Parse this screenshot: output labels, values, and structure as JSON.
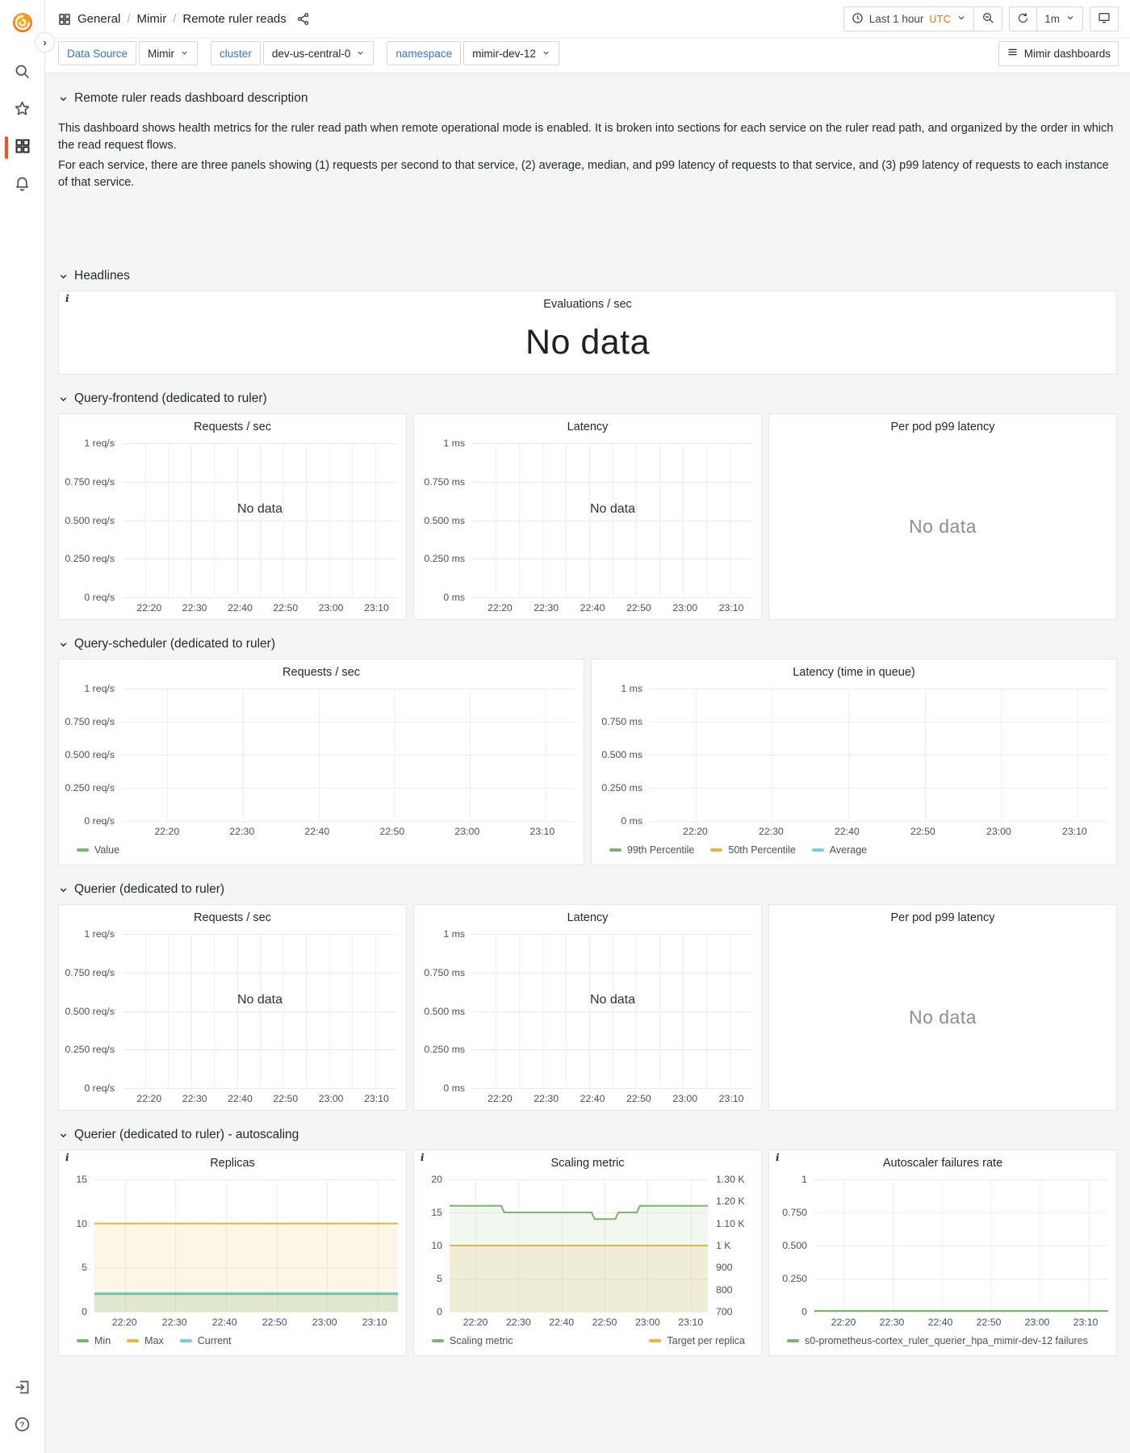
{
  "header": {
    "breadcrumb": {
      "root": "General",
      "sep1": "/",
      "group": "Mimir",
      "sep2": "/",
      "page": "Remote ruler reads"
    },
    "time_picker": {
      "range_label": "Last 1 hour",
      "timezone": "UTC"
    },
    "refresh": {
      "interval": "1m"
    }
  },
  "toolbar": {
    "variables": [
      {
        "label": "Data Source",
        "value": "Mimir"
      },
      {
        "label": "cluster",
        "value": "dev-us-central-0"
      },
      {
        "label": "namespace",
        "value": "mimir-dev-12"
      }
    ],
    "dashboards_button": "Mimir dashboards"
  },
  "sections": {
    "description": {
      "title": "Remote ruler reads dashboard description",
      "paragraph1": "This dashboard shows health metrics for the ruler read path when remote operational mode is enabled. It is broken into sections for each service on the ruler read path, and organized by the order in which the read request flows.",
      "paragraph2": "For each service, there are three panels showing (1) requests per second to that service, (2) average, median, and p99 latency of requests to that service, and (3) p99 latency of requests to each instance of that service."
    },
    "headlines": {
      "title": "Headlines"
    },
    "query_frontend": {
      "title": "Query-frontend (dedicated to ruler)"
    },
    "query_scheduler": {
      "title": "Query-scheduler (dedicated to ruler)"
    },
    "querier": {
      "title": "Querier (dedicated to ruler)"
    },
    "querier_autoscaling": {
      "title": "Querier (dedicated to ruler) - autoscaling"
    }
  },
  "panels": {
    "evaluations": {
      "title": "Evaluations / sec",
      "no_data": "No data"
    },
    "qf_per_pod": {
      "title": "Per pod p99 latency",
      "no_data": "No data"
    },
    "querier_per_pod": {
      "title": "Per pod p99 latency",
      "no_data": "No data"
    }
  },
  "colors": {
    "green": "#7EB26D",
    "yellow": "#EAB839",
    "cyan": "#6ED0E0",
    "link_blue": "#3871DC",
    "utc_orange": "#E87400",
    "active_orange": "#F4511E"
  },
  "chart_data": {
    "qf_requests": {
      "type": "line",
      "title": "Requests / sec",
      "no_data": "No data",
      "ylim": [
        0,
        1
      ],
      "xlim": [
        0,
        60
      ],
      "y_axis_width": 68,
      "v_grid": "fine",
      "y_ticks": [
        {
          "label": "1 req/s",
          "v": 1
        },
        {
          "label": "0.750 req/s",
          "v": 0.75
        },
        {
          "label": "0.500 req/s",
          "v": 0.5
        },
        {
          "label": "0.250 req/s",
          "v": 0.25
        },
        {
          "label": "0 req/s",
          "v": 0
        }
      ],
      "x_ticks": [
        {
          "label": "22:20",
          "v": 6
        },
        {
          "label": "22:30",
          "v": 16
        },
        {
          "label": "22:40",
          "v": 26
        },
        {
          "label": "22:50",
          "v": 36
        },
        {
          "label": "23:00",
          "v": 46
        },
        {
          "label": "23:10",
          "v": 56
        }
      ],
      "series": [],
      "legend": []
    },
    "qf_latency": {
      "type": "line",
      "title": "Latency",
      "no_data": "No data",
      "ylim": [
        0,
        1
      ],
      "xlim": [
        0,
        60
      ],
      "y_axis_width": 62,
      "v_grid": "fine",
      "y_ticks": [
        {
          "label": "1 ms",
          "v": 1
        },
        {
          "label": "0.750 ms",
          "v": 0.75
        },
        {
          "label": "0.500 ms",
          "v": 0.5
        },
        {
          "label": "0.250 ms",
          "v": 0.25
        },
        {
          "label": "0 ms",
          "v": 0
        }
      ],
      "x_ticks": [
        {
          "label": "22:20",
          "v": 6
        },
        {
          "label": "22:30",
          "v": 16
        },
        {
          "label": "22:40",
          "v": 26
        },
        {
          "label": "22:50",
          "v": 36
        },
        {
          "label": "23:00",
          "v": 46
        },
        {
          "label": "23:10",
          "v": 56
        }
      ],
      "series": [],
      "legend": []
    },
    "qs_requests": {
      "type": "line",
      "title": "Requests / sec",
      "ylim": [
        0,
        1
      ],
      "xlim": [
        0,
        60
      ],
      "y_axis_width": 68,
      "v_grid": "ticks",
      "y_ticks": [
        {
          "label": "1 req/s",
          "v": 1
        },
        {
          "label": "0.750 req/s",
          "v": 0.75
        },
        {
          "label": "0.500 req/s",
          "v": 0.5
        },
        {
          "label": "0.250 req/s",
          "v": 0.25
        },
        {
          "label": "0 req/s",
          "v": 0
        }
      ],
      "x_ticks": [
        {
          "label": "22:20",
          "v": 6
        },
        {
          "label": "22:30",
          "v": 16
        },
        {
          "label": "22:40",
          "v": 26
        },
        {
          "label": "22:50",
          "v": 36
        },
        {
          "label": "23:00",
          "v": 46
        },
        {
          "label": "23:10",
          "v": 56
        }
      ],
      "series": [],
      "legend": [
        {
          "label": "Value",
          "color": "#7EB26D"
        }
      ]
    },
    "qs_latency": {
      "type": "line",
      "title": "Latency (time in queue)",
      "ylim": [
        0,
        1
      ],
      "xlim": [
        0,
        60
      ],
      "y_axis_width": 62,
      "v_grid": "ticks",
      "y_ticks": [
        {
          "label": "1 ms",
          "v": 1
        },
        {
          "label": "0.750 ms",
          "v": 0.75
        },
        {
          "label": "0.500 ms",
          "v": 0.5
        },
        {
          "label": "0.250 ms",
          "v": 0.25
        },
        {
          "label": "0 ms",
          "v": 0
        }
      ],
      "x_ticks": [
        {
          "label": "22:20",
          "v": 6
        },
        {
          "label": "22:30",
          "v": 16
        },
        {
          "label": "22:40",
          "v": 26
        },
        {
          "label": "22:50",
          "v": 36
        },
        {
          "label": "23:00",
          "v": 46
        },
        {
          "label": "23:10",
          "v": 56
        }
      ],
      "series": [],
      "legend": [
        {
          "label": "99th Percentile",
          "color": "#7EB26D"
        },
        {
          "label": "50th Percentile",
          "color": "#EAB839"
        },
        {
          "label": "Average",
          "color": "#6ED0E0"
        }
      ]
    },
    "querier_requests": {
      "type": "line",
      "title": "Requests / sec",
      "no_data": "No data",
      "ylim": [
        0,
        1
      ],
      "xlim": [
        0,
        60
      ],
      "y_axis_width": 68,
      "v_grid": "fine",
      "y_ticks": [
        {
          "label": "1 req/s",
          "v": 1
        },
        {
          "label": "0.750 req/s",
          "v": 0.75
        },
        {
          "label": "0.500 req/s",
          "v": 0.5
        },
        {
          "label": "0.250 req/s",
          "v": 0.25
        },
        {
          "label": "0 req/s",
          "v": 0
        }
      ],
      "x_ticks": [
        {
          "label": "22:20",
          "v": 6
        },
        {
          "label": "22:30",
          "v": 16
        },
        {
          "label": "22:40",
          "v": 26
        },
        {
          "label": "22:50",
          "v": 36
        },
        {
          "label": "23:00",
          "v": 46
        },
        {
          "label": "23:10",
          "v": 56
        }
      ],
      "series": [],
      "legend": []
    },
    "querier_latency": {
      "type": "line",
      "title": "Latency",
      "no_data": "No data",
      "ylim": [
        0,
        1
      ],
      "xlim": [
        0,
        60
      ],
      "y_axis_width": 62,
      "v_grid": "fine",
      "y_ticks": [
        {
          "label": "1 ms",
          "v": 1
        },
        {
          "label": "0.750 ms",
          "v": 0.75
        },
        {
          "label": "0.500 ms",
          "v": 0.5
        },
        {
          "label": "0.250 ms",
          "v": 0.25
        },
        {
          "label": "0 ms",
          "v": 0
        }
      ],
      "x_ticks": [
        {
          "label": "22:20",
          "v": 6
        },
        {
          "label": "22:30",
          "v": 16
        },
        {
          "label": "22:40",
          "v": 26
        },
        {
          "label": "22:50",
          "v": 36
        },
        {
          "label": "23:00",
          "v": 46
        },
        {
          "label": "23:10",
          "v": 56
        }
      ],
      "series": [],
      "legend": []
    },
    "replicas": {
      "type": "line",
      "title": "Replicas",
      "info": true,
      "ylim": [
        0,
        15
      ],
      "xlim": [
        0,
        60
      ],
      "y_axis_width": 34,
      "v_grid": "ticks",
      "y_ticks": [
        {
          "label": "15",
          "v": 15
        },
        {
          "label": "10",
          "v": 10
        },
        {
          "label": "5",
          "v": 5
        },
        {
          "label": "0",
          "v": 0
        }
      ],
      "x_ticks": [
        {
          "label": "22:20",
          "v": 6
        },
        {
          "label": "22:30",
          "v": 16
        },
        {
          "label": "22:40",
          "v": 26
        },
        {
          "label": "22:50",
          "v": 36
        },
        {
          "label": "23:00",
          "v": 46
        },
        {
          "label": "23:10",
          "v": 56
        }
      ],
      "series": [
        {
          "name": "Max",
          "color": "#EAB839",
          "points": [
            [
              0,
              10
            ],
            [
              60,
              10
            ]
          ],
          "fill": "rgba(234,184,57,0.12)"
        },
        {
          "name": "Min",
          "color": "#7EB26D",
          "points": [
            [
              0,
              2
            ],
            [
              60,
              2
            ]
          ],
          "fill": "rgba(126,178,109,0.22)"
        },
        {
          "name": "Current",
          "color": "#6ED0E0",
          "points": [
            [
              0,
              2.12
            ],
            [
              60,
              2.12
            ]
          ]
        }
      ],
      "legend": [
        {
          "label": "Min",
          "color": "#7EB26D"
        },
        {
          "label": "Max",
          "color": "#EAB839"
        },
        {
          "label": "Current",
          "color": "#6ED0E0"
        }
      ]
    },
    "scaling_metric": {
      "type": "line",
      "title": "Scaling metric",
      "info": true,
      "ylim": [
        0,
        20
      ],
      "xlim": [
        0,
        60
      ],
      "y_axis_width": 34,
      "v_grid": "ticks",
      "ylim_right": [
        700,
        1300
      ],
      "y_axis_right_width": 56,
      "y_ticks": [
        {
          "label": "20",
          "v": 20
        },
        {
          "label": "15",
          "v": 15
        },
        {
          "label": "10",
          "v": 10
        },
        {
          "label": "5",
          "v": 5
        },
        {
          "label": "0",
          "v": 0
        }
      ],
      "y_ticks_right": [
        {
          "label": "1.30 K",
          "v": 1300
        },
        {
          "label": "1.20 K",
          "v": 1200
        },
        {
          "label": "1.10 K",
          "v": 1100
        },
        {
          "label": "1 K",
          "v": 1000
        },
        {
          "label": "900",
          "v": 900
        },
        {
          "label": "800",
          "v": 800
        },
        {
          "label": "700",
          "v": 700
        }
      ],
      "x_ticks": [
        {
          "label": "22:20",
          "v": 6
        },
        {
          "label": "22:30",
          "v": 16
        },
        {
          "label": "22:40",
          "v": 26
        },
        {
          "label": "22:50",
          "v": 36
        },
        {
          "label": "23:00",
          "v": 46
        },
        {
          "label": "23:10",
          "v": 56
        }
      ],
      "series": [
        {
          "name": "Target per replica",
          "color": "#EAB839",
          "points": [
            [
              0,
              10
            ],
            [
              60,
              10
            ]
          ],
          "fill": "rgba(234,184,57,0.15)"
        },
        {
          "name": "Scaling metric",
          "color": "#7EB26D",
          "points": [
            [
              0,
              16
            ],
            [
              12,
              16
            ],
            [
              12.7,
              15
            ],
            [
              33,
              15
            ],
            [
              33.7,
              14
            ],
            [
              38.5,
              14
            ],
            [
              39.2,
              15
            ],
            [
              43.5,
              15
            ],
            [
              44.2,
              16
            ],
            [
              60,
              16
            ]
          ],
          "fill": "rgba(126,178,109,0.10)"
        }
      ],
      "legend": [
        {
          "label": "Scaling metric",
          "color": "#7EB26D"
        },
        {
          "label": "Target per replica",
          "color": "#EAB839"
        }
      ],
      "legend_layout": "split"
    },
    "autoscaler_failures": {
      "type": "line",
      "title": "Autoscaler failures rate",
      "info": true,
      "ylim": [
        0,
        1
      ],
      "xlim": [
        0,
        60
      ],
      "y_axis_width": 46,
      "v_grid": "ticks",
      "y_ticks": [
        {
          "label": "1",
          "v": 1
        },
        {
          "label": "0.750",
          "v": 0.75
        },
        {
          "label": "0.500",
          "v": 0.5
        },
        {
          "label": "0.250",
          "v": 0.25
        },
        {
          "label": "0",
          "v": 0
        }
      ],
      "x_ticks": [
        {
          "label": "22:20",
          "v": 6
        },
        {
          "label": "22:30",
          "v": 16
        },
        {
          "label": "22:40",
          "v": 26
        },
        {
          "label": "22:50",
          "v": 36
        },
        {
          "label": "23:00",
          "v": 46
        },
        {
          "label": "23:10",
          "v": 56
        }
      ],
      "series": [
        {
          "name": "failures",
          "color": "#7EB26D",
          "points": [
            [
              0,
              0.006
            ],
            [
              60,
              0.006
            ]
          ]
        }
      ],
      "legend": [
        {
          "label": "s0-prometheus-cortex_ruler_querier_hpa_mimir-dev-12 failures",
          "color": "#7EB26D"
        }
      ]
    }
  }
}
